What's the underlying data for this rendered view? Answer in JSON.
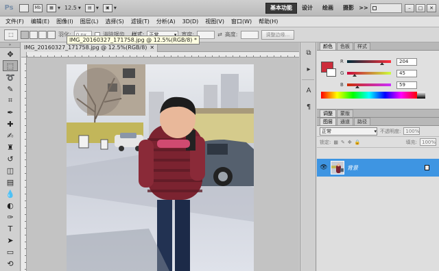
{
  "appbar": {
    "logo": "Ps",
    "mb_label": "Mb",
    "zoom": "12.5",
    "workspaces": [
      "基本功能",
      "设计",
      "绘画",
      "摄影"
    ],
    "more": ">>",
    "cs_live": "CS Live"
  },
  "menu": [
    "文件(F)",
    "编辑(E)",
    "图像(I)",
    "图层(L)",
    "选择(S)",
    "滤镜(T)",
    "分析(A)",
    "3D(D)",
    "视图(V)",
    "窗口(W)",
    "帮助(H)"
  ],
  "options": {
    "feather_label": "羽化:",
    "feather_value": "0 px",
    "antialias_label": "消除锯齿",
    "style_label": "样式:",
    "style_value": "正常",
    "width_label": "宽度:",
    "height_label": "高度:",
    "refine_edge": "调整边缘..."
  },
  "document": {
    "tab_title": "IMG_20160327_171758.jpg @ 12.5%(RGB/8)",
    "tooltip": "IMG_20160327_171758.jpg @ 12.5%(RGB/8) *"
  },
  "color_panel": {
    "tabs": [
      "颜色",
      "色板",
      "样式"
    ],
    "r_label": "R",
    "r_value": "204",
    "g_label": "G",
    "g_value": "45",
    "b_label": "B",
    "b_value": "59",
    "r": 204,
    "g": 45,
    "b": 59,
    "fg_color": "#cc2d3b"
  },
  "adjust_tabs": [
    "调整",
    "蒙版"
  ],
  "layers_panel": {
    "tabs": [
      "图层",
      "通道",
      "路径"
    ],
    "blend_mode": "正常",
    "opacity_label": "不透明度:",
    "opacity_value": "100%",
    "lock_label": "锁定:",
    "fill_label": "填充:",
    "fill_value": "100%",
    "layer_name": "背景"
  }
}
